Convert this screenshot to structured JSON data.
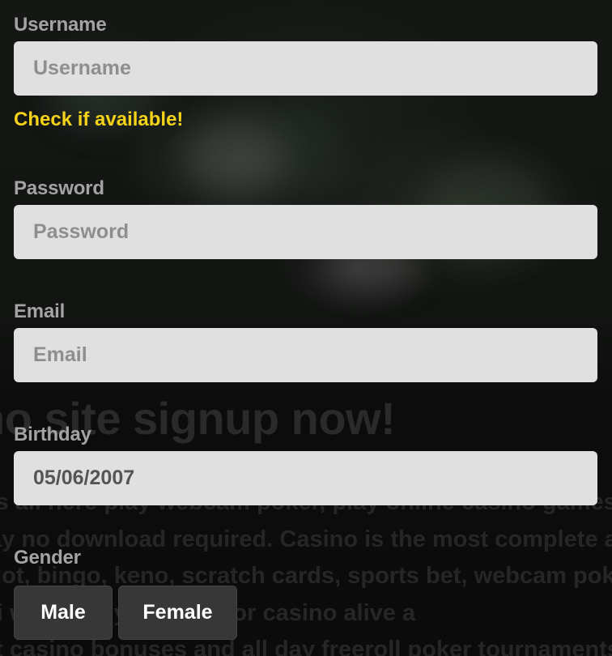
{
  "background": {
    "headline": "no site signup now!",
    "paragraph_lines": [
      "t's all here play webcam poker, play online casino games, li",
      "lay no download required. Casino is the most complete and",
      "slot, bingo, keno, scratch cards, sports bet, webcam poker, b",
      "di                            will keep your love for casino alive a",
      "at casino bonuses and all day freeroll poker tournaments"
    ]
  },
  "form": {
    "username": {
      "label": "Username",
      "placeholder": "Username",
      "check_link": "Check if available!"
    },
    "password": {
      "label": "Password",
      "placeholder": "Password"
    },
    "email": {
      "label": "Email",
      "placeholder": "Email"
    },
    "birthday": {
      "label": "Birthday",
      "value": "05/06/2007"
    },
    "gender": {
      "label": "Gender",
      "options": [
        "Male",
        "Female"
      ]
    }
  },
  "colors": {
    "accent_link": "#f4d21a",
    "field_bg": "#e0e0e0",
    "button_bg": "#373737"
  }
}
